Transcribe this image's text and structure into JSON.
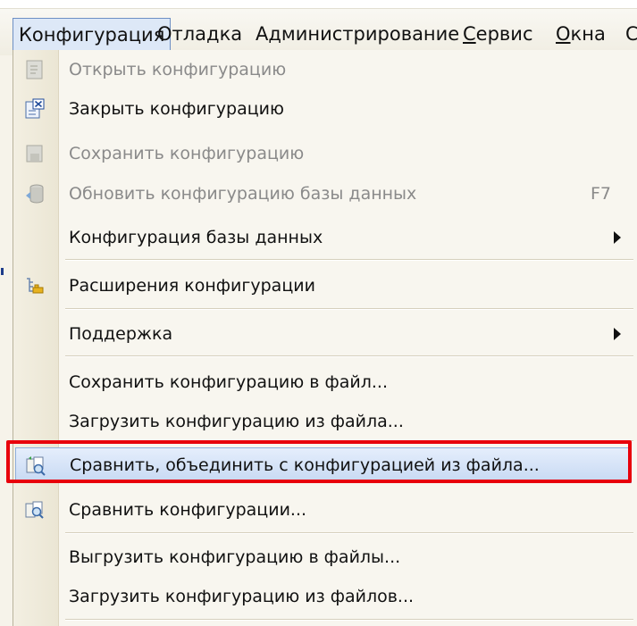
{
  "menubar": {
    "items": [
      {
        "label": "Конфигурация"
      },
      {
        "label": "Отладка"
      },
      {
        "label": "Администрирование"
      },
      {
        "label": "Сервис"
      },
      {
        "label": "Окна"
      },
      {
        "label": "С"
      }
    ]
  },
  "menu": {
    "items": [
      {
        "label": "Открыть конфигурацию",
        "enabled": false,
        "icon": "open-config-icon"
      },
      {
        "label": "Закрыть конфигурацию",
        "enabled": true,
        "icon": "close-config-icon"
      },
      {
        "label": "Сохранить конфигурацию",
        "enabled": false,
        "icon": "save-config-icon"
      },
      {
        "label": "Обновить конфигурацию базы данных",
        "enabled": false,
        "shortcut": "F7",
        "icon": "update-db-icon"
      },
      {
        "label": "Конфигурация базы данных",
        "enabled": true,
        "submenu": true
      },
      {
        "label": "Расширения конфигурации",
        "enabled": true,
        "icon": "extensions-icon"
      },
      {
        "label": "Поддержка",
        "enabled": true,
        "submenu": true
      },
      {
        "label": "Сохранить конфигурацию в файл...",
        "enabled": true
      },
      {
        "label": "Загрузить конфигурацию из файла...",
        "enabled": true
      },
      {
        "label": "Сравнить, объединить с конфигурацией из файла...",
        "enabled": true,
        "highlighted": true,
        "icon": "compare-merge-icon"
      },
      {
        "label": "Сравнить конфигурации...",
        "enabled": true,
        "icon": "compare-icon"
      },
      {
        "label": "Выгрузить конфигурацию в файлы...",
        "enabled": true
      },
      {
        "label": "Загрузить конфигурацию из файлов...",
        "enabled": true
      }
    ]
  },
  "colors": {
    "highlight": "#c7d9f3",
    "callout_border": "#e8000b",
    "disabled_text": "#8a8a8a"
  }
}
